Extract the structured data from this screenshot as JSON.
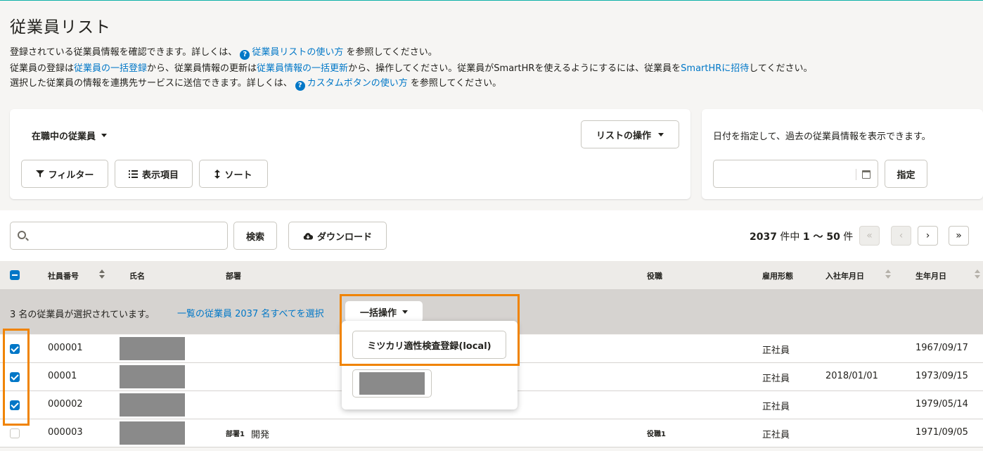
{
  "page": {
    "title": "従業員リスト",
    "desc1_pre": "登録されている従業員情報を確認できます。詳しくは、",
    "desc1_link": "従業員リストの使い方",
    "desc1_post": "を参照してください。",
    "desc2_a": "従業員の登録は",
    "desc2_link1": "従業員の一括登録",
    "desc2_b": "から、従業員情報の更新は",
    "desc2_link2": "従業員情報の一括更新",
    "desc2_c": "から、操作してください。従業員がSmartHRを使えるようにするには、従業員を",
    "desc2_link3": "SmartHRに招待",
    "desc2_d": "してください。",
    "desc3_pre": "選択した従業員の情報を連携先サービスに送信できます。詳しくは、",
    "desc3_link": "カスタムボタンの使い方",
    "desc3_post": "を参照してください。"
  },
  "filters": {
    "status_label": "在職中の従業員",
    "list_ops_label": "リストの操作",
    "filter_label": "フィルター",
    "columns_label": "表示項目",
    "sort_label": "ソート",
    "date_hint": "日付を指定して、過去の従業員情報を表示できます。",
    "date_value": "",
    "apply_label": "指定"
  },
  "search": {
    "placeholder": "",
    "search_label": "検索",
    "download_label": "ダウンロード"
  },
  "pager": {
    "total": "2037",
    "mid": " 件中 ",
    "range": "1 〜 50",
    "unit": " 件",
    "first": "«",
    "prev": "‹",
    "next": "›",
    "last": "»"
  },
  "table": {
    "headers": [
      "社員番号",
      "氏名",
      "部署",
      "役職",
      "雇用形態",
      "入社年月日",
      "生年月日"
    ],
    "selection_text": "3 名の従業員が選択されています。",
    "select_all_text": "一覧の従業員 2037 名すべてを選択",
    "bulk_label": "一括操作",
    "rows": [
      {
        "id": "000001",
        "dept_label": "",
        "dept": "",
        "role": "",
        "type": "正社員",
        "joined": "",
        "birth": "1967/09/17",
        "checked": true
      },
      {
        "id": "00001",
        "dept_label": "",
        "dept": "",
        "role": "",
        "type": "正社員",
        "joined": "2018/01/01",
        "birth": "1973/09/15",
        "checked": true
      },
      {
        "id": "000002",
        "dept_label": "",
        "dept": "",
        "role": "",
        "type": "正社員",
        "joined": "",
        "birth": "1979/05/14",
        "checked": true
      },
      {
        "id": "000003",
        "dept_label": "部署1",
        "dept": "開発",
        "role": "役職1",
        "type": "正社員",
        "joined": "",
        "birth": "1971/09/05",
        "checked": false
      }
    ]
  },
  "bulk_menu": {
    "item1": "ミツカリ適性検査登録(local)"
  },
  "colors": {
    "accent": "#0077c7",
    "highlight": "#f08300",
    "top_border": "#0fb2a8"
  }
}
